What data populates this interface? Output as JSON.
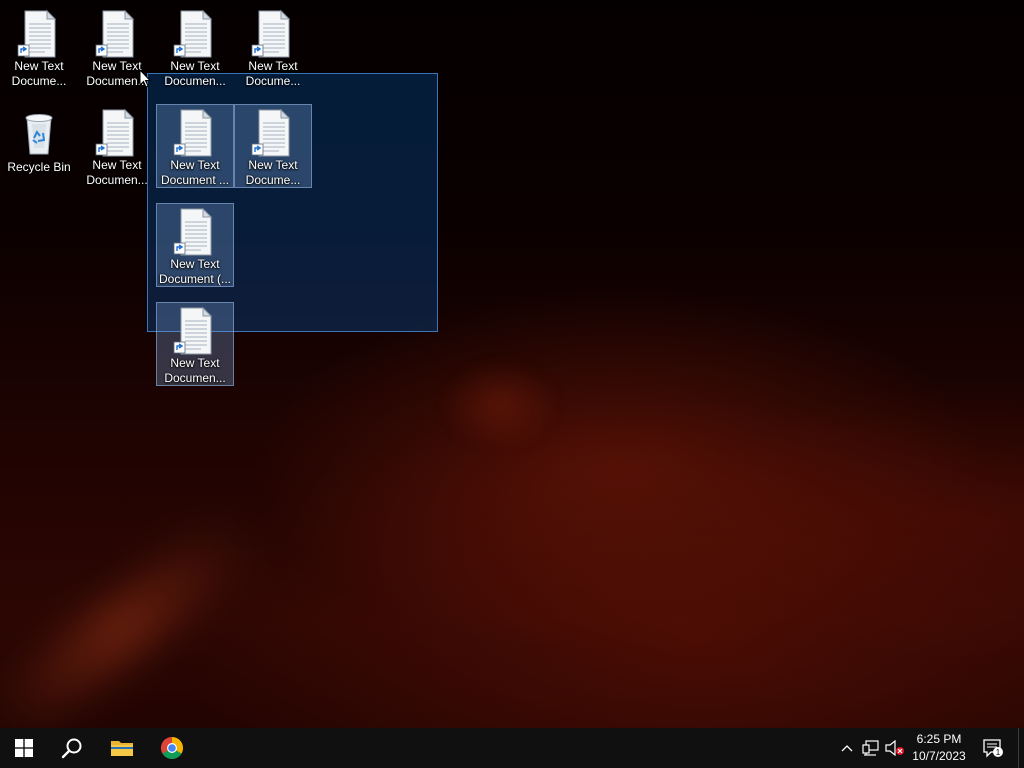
{
  "desktop": {
    "icons": [
      {
        "id": "doc1",
        "label": "New Text\nDocume...",
        "type": "text-document",
        "shortcut": true,
        "selected": false
      },
      {
        "id": "doc2",
        "label": "New Text\nDocumen...",
        "type": "text-document",
        "shortcut": true,
        "selected": false
      },
      {
        "id": "doc3",
        "label": "New Text\nDocumen...",
        "type": "text-document",
        "shortcut": true,
        "selected": false
      },
      {
        "id": "doc4",
        "label": "New Text\nDocume...",
        "type": "text-document",
        "shortcut": true,
        "selected": false
      },
      {
        "id": "recycle",
        "label": "Recycle Bin",
        "type": "recycle-bin",
        "shortcut": false,
        "selected": false
      },
      {
        "id": "doc5",
        "label": "New Text\nDocumen...",
        "type": "text-document",
        "shortcut": true,
        "selected": false
      },
      {
        "id": "doc6",
        "label": "New Text\nDocument ...",
        "type": "text-document",
        "shortcut": true,
        "selected": true
      },
      {
        "id": "doc7",
        "label": "New Text\nDocume...",
        "type": "text-document",
        "shortcut": true,
        "selected": true
      },
      {
        "id": "doc8",
        "label": "New Text\nDocument (...",
        "type": "text-document",
        "shortcut": true,
        "selected": true
      },
      {
        "id": "doc9",
        "label": "New Text\nDocumen...",
        "type": "text-document",
        "shortcut": true,
        "selected": true
      }
    ]
  },
  "taskbar": {
    "pinned": [
      {
        "name": "start-button",
        "icon": "windows-logo-icon"
      },
      {
        "name": "search-button",
        "icon": "search-icon"
      },
      {
        "name": "file-explorer-button",
        "icon": "folder-icon"
      },
      {
        "name": "chrome-button",
        "icon": "chrome-icon"
      }
    ],
    "tray": {
      "icons": [
        "chevron-up-icon",
        "network-icon",
        "volume-muted-icon"
      ],
      "time": "6:25 PM",
      "date": "10/7/2023",
      "notification_count": "1"
    }
  },
  "colors": {
    "selection_fill": "#0066cc",
    "taskbar": "#101010",
    "wallpaper_dark": "#050000",
    "wallpaper_red": "#2c0603"
  }
}
